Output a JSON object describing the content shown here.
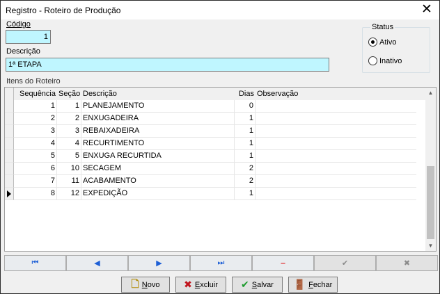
{
  "window": {
    "title": "Registro - Roteiro de Produção"
  },
  "form": {
    "codigo_label": "Código",
    "codigo_value": "1",
    "descricao_label": "Descrição",
    "descricao_value": "1ª ETAPA"
  },
  "status": {
    "title": "Status",
    "options": [
      {
        "label": "Ativo",
        "selected": true
      },
      {
        "label": "Inativo",
        "selected": false
      }
    ]
  },
  "grid": {
    "title": "Itens do Roteiro",
    "columns": [
      "Sequência",
      "Seção",
      "Descrição",
      "Dias",
      "Observação"
    ],
    "rows": [
      {
        "seq": "1",
        "secao": "1",
        "descricao": "PLANEJAMENTO",
        "dias": "0",
        "obs": ""
      },
      {
        "seq": "2",
        "secao": "2",
        "descricao": "ENXUGADEIRA",
        "dias": "1",
        "obs": ""
      },
      {
        "seq": "3",
        "secao": "3",
        "descricao": "REBAIXADEIRA",
        "dias": "1",
        "obs": ""
      },
      {
        "seq": "4",
        "secao": "4",
        "descricao": "RECURTIMENTO",
        "dias": "1",
        "obs": ""
      },
      {
        "seq": "5",
        "secao": "5",
        "descricao": "ENXUGA RECURTIDA",
        "dias": "1",
        "obs": ""
      },
      {
        "seq": "6",
        "secao": "10",
        "descricao": "SECAGEM",
        "dias": "2",
        "obs": ""
      },
      {
        "seq": "7",
        "secao": "11",
        "descricao": "ACABAMENTO",
        "dias": "2",
        "obs": ""
      },
      {
        "seq": "8",
        "secao": "12",
        "descricao": "EXPEDIÇÃO",
        "dias": "1",
        "obs": ""
      }
    ],
    "current_row": 8
  },
  "navigator": {
    "first": "⏮",
    "prior": "◀",
    "next": "▶",
    "last": "⏭",
    "delete": "‒",
    "post": "✔",
    "cancel": "✖"
  },
  "buttons": {
    "novo_prefix": "N",
    "novo_rest": "ovo",
    "excluir_prefix": "E",
    "excluir_rest": "xcluir",
    "salvar_prefix": "S",
    "salvar_rest": "alvar",
    "fechar_prefix": "F",
    "fechar_rest": "echar"
  },
  "colors": {
    "field_bg": "#bff6ff",
    "excluir_icon": "#c0131b",
    "salvar_icon": "#1e9b2e",
    "nav_blue": "#1d5fd6"
  }
}
